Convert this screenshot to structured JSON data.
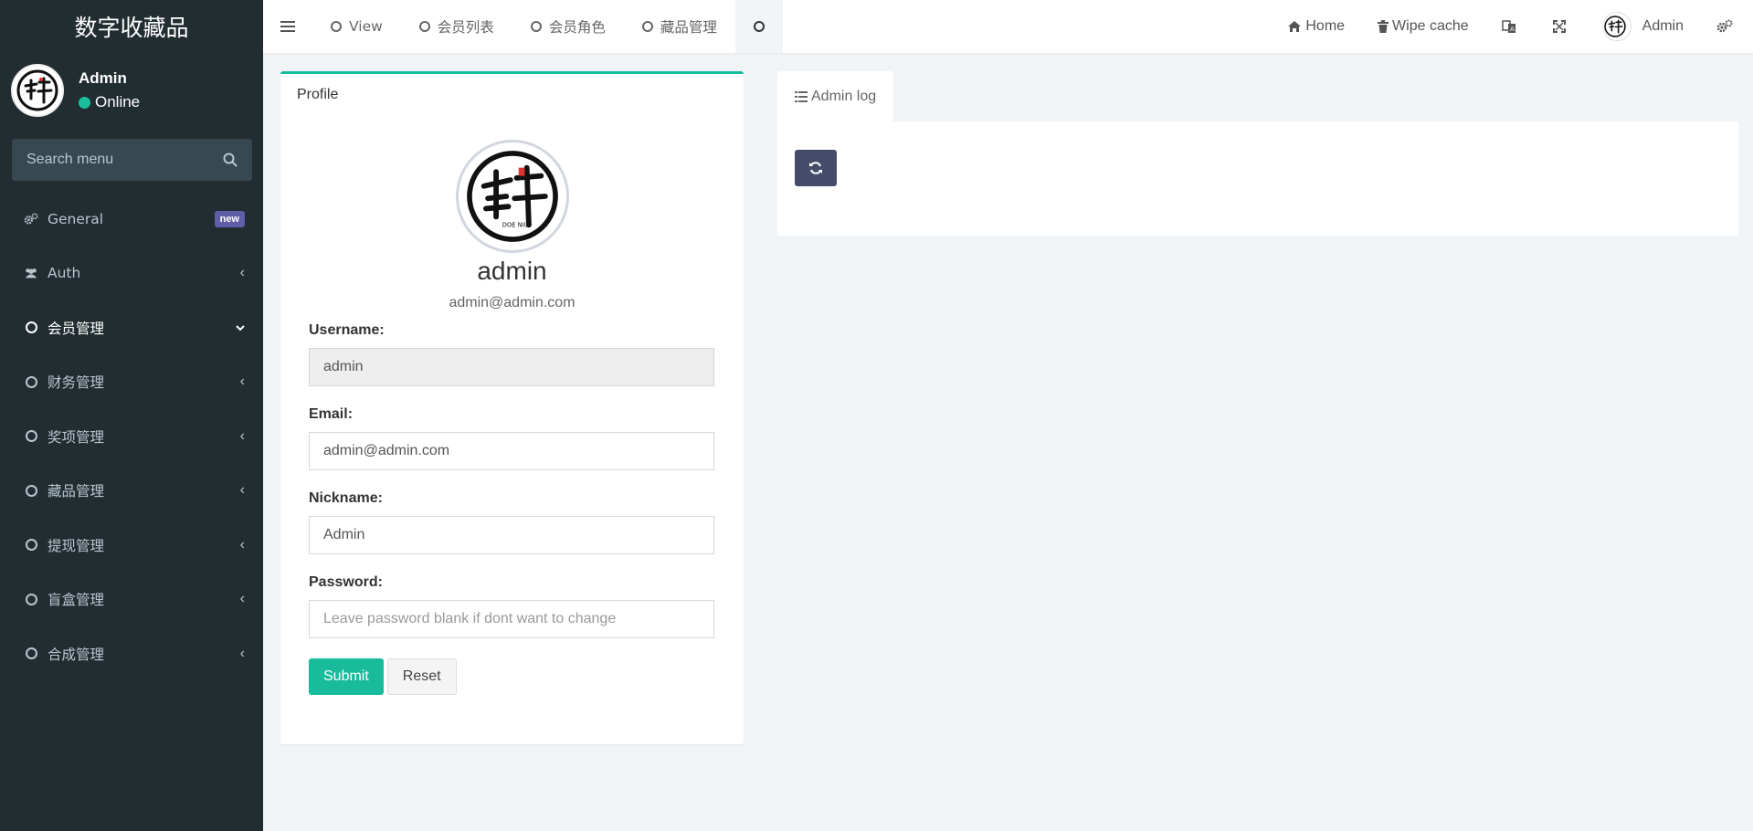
{
  "brand": {
    "title": "数字收藏品"
  },
  "user": {
    "name": "Admin",
    "status": "Online"
  },
  "search": {
    "placeholder": "Search menu"
  },
  "menu": [
    {
      "label": "General",
      "icon": "gears-icon",
      "badge": "new"
    },
    {
      "label": "Auth",
      "icon": "users-icon"
    },
    {
      "label": "会员管理",
      "icon": "circle-icon",
      "expanded": true
    },
    {
      "label": "财务管理",
      "icon": "circle-icon"
    },
    {
      "label": "奖项管理",
      "icon": "circle-icon"
    },
    {
      "label": "藏品管理",
      "icon": "circle-icon"
    },
    {
      "label": "提现管理",
      "icon": "circle-icon"
    },
    {
      "label": "盲盒管理",
      "icon": "circle-icon"
    },
    {
      "label": "合成管理",
      "icon": "circle-icon"
    }
  ],
  "tabs": [
    {
      "label": "View"
    },
    {
      "label": "会员列表"
    },
    {
      "label": "会员角色"
    },
    {
      "label": "藏品管理"
    },
    {
      "label": ""
    }
  ],
  "nav": {
    "home": "Home",
    "wipe_cache": "Wipe cache",
    "admin": "Admin"
  },
  "profile": {
    "title": "Profile",
    "name": "admin",
    "email": "admin@admin.com",
    "username_label": "Username:",
    "username_value": "admin",
    "email_label": "Email:",
    "email_value": "admin@admin.com",
    "nickname_label": "Nickname:",
    "nickname_value": "Admin",
    "password_label": "Password:",
    "password_placeholder": "Leave password blank if dont want to change",
    "submit": "Submit",
    "reset": "Reset"
  },
  "log": {
    "tab_label": "Admin log"
  },
  "colors": {
    "sidebar": "#222d32",
    "accent": "#18bc9c",
    "badge": "#605ca8",
    "refresh": "#444c69"
  }
}
